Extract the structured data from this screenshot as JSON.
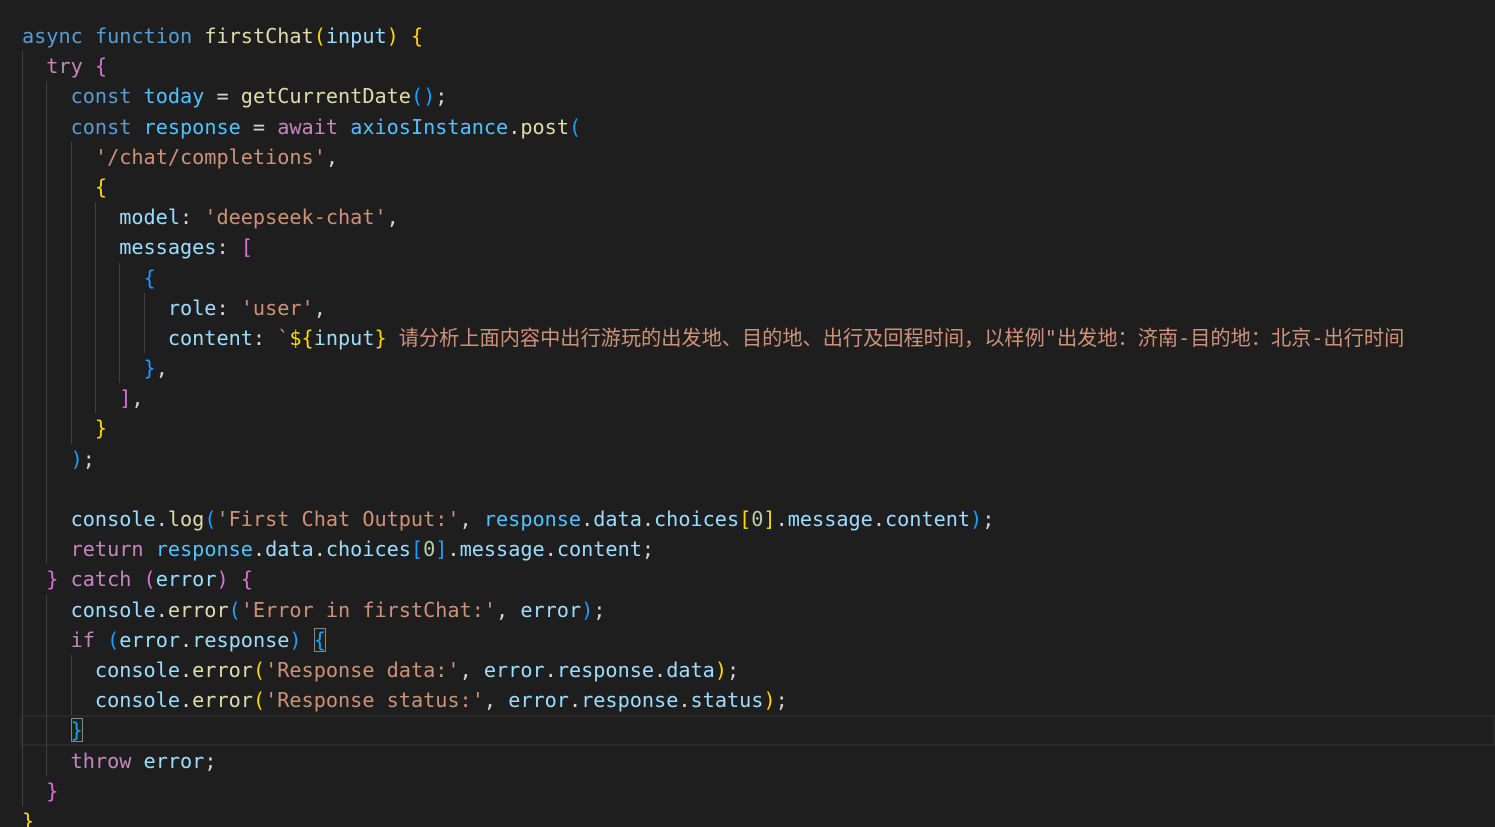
{
  "theme": {
    "background": "#1e1e1e",
    "text": "#d4d4d4",
    "indent_guide": "#404040",
    "line_highlight": "#282828",
    "bracket_match_border": "#888888",
    "token_colors": {
      "kw": "#569cd6",
      "ctl": "#c586c0",
      "fn": "#dcdcaa",
      "var": "#9cdcfe",
      "const": "#4fc1ff",
      "str": "#ce9178",
      "num": "#b5cea8",
      "p": "#d4d4d4",
      "b1": "#ffd700",
      "b2": "#da70d6",
      "b3": "#179fff"
    }
  },
  "lines": [
    {
      "indent": 0,
      "tokens": [
        {
          "t": "async",
          "c": "kw"
        },
        {
          "t": " ",
          "c": "p"
        },
        {
          "t": "function",
          "c": "kw"
        },
        {
          "t": " ",
          "c": "p"
        },
        {
          "t": "firstChat",
          "c": "fn"
        },
        {
          "t": "(",
          "c": "b1"
        },
        {
          "t": "input",
          "c": "var"
        },
        {
          "t": ")",
          "c": "b1"
        },
        {
          "t": " ",
          "c": "p"
        },
        {
          "t": "{",
          "c": "b1"
        }
      ]
    },
    {
      "indent": 2,
      "tokens": [
        {
          "t": "try",
          "c": "ctl"
        },
        {
          "t": " ",
          "c": "p"
        },
        {
          "t": "{",
          "c": "b2"
        }
      ]
    },
    {
      "indent": 4,
      "tokens": [
        {
          "t": "const",
          "c": "kw"
        },
        {
          "t": " ",
          "c": "p"
        },
        {
          "t": "today",
          "c": "const"
        },
        {
          "t": " = ",
          "c": "p"
        },
        {
          "t": "getCurrentDate",
          "c": "fn"
        },
        {
          "t": "()",
          "c": "b3"
        },
        {
          "t": ";",
          "c": "p"
        }
      ]
    },
    {
      "indent": 4,
      "tokens": [
        {
          "t": "const",
          "c": "kw"
        },
        {
          "t": " ",
          "c": "p"
        },
        {
          "t": "response",
          "c": "const"
        },
        {
          "t": " = ",
          "c": "p"
        },
        {
          "t": "await",
          "c": "ctl"
        },
        {
          "t": " ",
          "c": "p"
        },
        {
          "t": "axiosInstance",
          "c": "const"
        },
        {
          "t": ".",
          "c": "p"
        },
        {
          "t": "post",
          "c": "fn"
        },
        {
          "t": "(",
          "c": "b3"
        }
      ]
    },
    {
      "indent": 6,
      "tokens": [
        {
          "t": "'/chat/completions'",
          "c": "str"
        },
        {
          "t": ",",
          "c": "p"
        }
      ]
    },
    {
      "indent": 6,
      "tokens": [
        {
          "t": "{",
          "c": "b1"
        }
      ]
    },
    {
      "indent": 8,
      "tokens": [
        {
          "t": "model",
          "c": "var"
        },
        {
          "t": ": ",
          "c": "p"
        },
        {
          "t": "'deepseek-chat'",
          "c": "str"
        },
        {
          "t": ",",
          "c": "p"
        }
      ]
    },
    {
      "indent": 8,
      "tokens": [
        {
          "t": "messages",
          "c": "var"
        },
        {
          "t": ": ",
          "c": "p"
        },
        {
          "t": "[",
          "c": "b2"
        }
      ]
    },
    {
      "indent": 10,
      "tokens": [
        {
          "t": "{",
          "c": "b3"
        }
      ]
    },
    {
      "indent": 12,
      "tokens": [
        {
          "t": "role",
          "c": "var"
        },
        {
          "t": ": ",
          "c": "p"
        },
        {
          "t": "'user'",
          "c": "str"
        },
        {
          "t": ",",
          "c": "p"
        }
      ]
    },
    {
      "indent": 12,
      "tokens": [
        {
          "t": "content",
          "c": "var"
        },
        {
          "t": ": ",
          "c": "p"
        },
        {
          "t": "`",
          "c": "str"
        },
        {
          "t": "${",
          "c": "b1"
        },
        {
          "t": "input",
          "c": "var"
        },
        {
          "t": "}",
          "c": "b1"
        },
        {
          "t": " 请分析上面内容中出行游玩的出发地、目的地、出行及回程时间，以样例\"出发地：济南-目的地：北京-出行时间",
          "c": "str"
        }
      ]
    },
    {
      "indent": 10,
      "tokens": [
        {
          "t": "}",
          "c": "b3"
        },
        {
          "t": ",",
          "c": "p"
        }
      ]
    },
    {
      "indent": 8,
      "tokens": [
        {
          "t": "]",
          "c": "b2"
        },
        {
          "t": ",",
          "c": "p"
        }
      ]
    },
    {
      "indent": 6,
      "tokens": [
        {
          "t": "}",
          "c": "b1"
        }
      ]
    },
    {
      "indent": 4,
      "tokens": [
        {
          "t": ")",
          "c": "b3"
        },
        {
          "t": ";",
          "c": "p"
        }
      ]
    },
    {
      "indent": 4,
      "tokens": []
    },
    {
      "indent": 4,
      "tokens": [
        {
          "t": "console",
          "c": "var"
        },
        {
          "t": ".",
          "c": "p"
        },
        {
          "t": "log",
          "c": "fn"
        },
        {
          "t": "(",
          "c": "b3"
        },
        {
          "t": "'First Chat Output:'",
          "c": "str"
        },
        {
          "t": ", ",
          "c": "p"
        },
        {
          "t": "response",
          "c": "const"
        },
        {
          "t": ".",
          "c": "p"
        },
        {
          "t": "data",
          "c": "var"
        },
        {
          "t": ".",
          "c": "p"
        },
        {
          "t": "choices",
          "c": "var"
        },
        {
          "t": "[",
          "c": "b1"
        },
        {
          "t": "0",
          "c": "num"
        },
        {
          "t": "]",
          "c": "b1"
        },
        {
          "t": ".",
          "c": "p"
        },
        {
          "t": "message",
          "c": "var"
        },
        {
          "t": ".",
          "c": "p"
        },
        {
          "t": "content",
          "c": "var"
        },
        {
          "t": ")",
          "c": "b3"
        },
        {
          "t": ";",
          "c": "p"
        }
      ]
    },
    {
      "indent": 4,
      "tokens": [
        {
          "t": "return",
          "c": "ctl"
        },
        {
          "t": " ",
          "c": "p"
        },
        {
          "t": "response",
          "c": "const"
        },
        {
          "t": ".",
          "c": "p"
        },
        {
          "t": "data",
          "c": "var"
        },
        {
          "t": ".",
          "c": "p"
        },
        {
          "t": "choices",
          "c": "var"
        },
        {
          "t": "[",
          "c": "b3"
        },
        {
          "t": "0",
          "c": "num"
        },
        {
          "t": "]",
          "c": "b3"
        },
        {
          "t": ".",
          "c": "p"
        },
        {
          "t": "message",
          "c": "var"
        },
        {
          "t": ".",
          "c": "p"
        },
        {
          "t": "content",
          "c": "var"
        },
        {
          "t": ";",
          "c": "p"
        }
      ]
    },
    {
      "indent": 2,
      "tokens": [
        {
          "t": "}",
          "c": "b2"
        },
        {
          "t": " ",
          "c": "p"
        },
        {
          "t": "catch",
          "c": "ctl"
        },
        {
          "t": " ",
          "c": "p"
        },
        {
          "t": "(",
          "c": "b2"
        },
        {
          "t": "error",
          "c": "var"
        },
        {
          "t": ")",
          "c": "b2"
        },
        {
          "t": " ",
          "c": "p"
        },
        {
          "t": "{",
          "c": "b2"
        }
      ]
    },
    {
      "indent": 4,
      "tokens": [
        {
          "t": "console",
          "c": "var"
        },
        {
          "t": ".",
          "c": "p"
        },
        {
          "t": "error",
          "c": "fn"
        },
        {
          "t": "(",
          "c": "b3"
        },
        {
          "t": "'Error in firstChat:'",
          "c": "str"
        },
        {
          "t": ", ",
          "c": "p"
        },
        {
          "t": "error",
          "c": "var"
        },
        {
          "t": ")",
          "c": "b3"
        },
        {
          "t": ";",
          "c": "p"
        }
      ]
    },
    {
      "indent": 4,
      "tokens": [
        {
          "t": "if",
          "c": "ctl"
        },
        {
          "t": " ",
          "c": "p"
        },
        {
          "t": "(",
          "c": "b3"
        },
        {
          "t": "error",
          "c": "var"
        },
        {
          "t": ".",
          "c": "p"
        },
        {
          "t": "response",
          "c": "var"
        },
        {
          "t": ")",
          "c": "b3"
        },
        {
          "t": " ",
          "c": "p"
        },
        {
          "t": "{",
          "c": "b3",
          "match": true
        }
      ]
    },
    {
      "indent": 6,
      "tokens": [
        {
          "t": "console",
          "c": "var"
        },
        {
          "t": ".",
          "c": "p"
        },
        {
          "t": "error",
          "c": "fn"
        },
        {
          "t": "(",
          "c": "b1"
        },
        {
          "t": "'Response data:'",
          "c": "str"
        },
        {
          "t": ", ",
          "c": "p"
        },
        {
          "t": "error",
          "c": "var"
        },
        {
          "t": ".",
          "c": "p"
        },
        {
          "t": "response",
          "c": "var"
        },
        {
          "t": ".",
          "c": "p"
        },
        {
          "t": "data",
          "c": "var"
        },
        {
          "t": ")",
          "c": "b1"
        },
        {
          "t": ";",
          "c": "p"
        }
      ]
    },
    {
      "indent": 6,
      "tokens": [
        {
          "t": "console",
          "c": "var"
        },
        {
          "t": ".",
          "c": "p"
        },
        {
          "t": "error",
          "c": "fn"
        },
        {
          "t": "(",
          "c": "b1"
        },
        {
          "t": "'Response status:'",
          "c": "str"
        },
        {
          "t": ", ",
          "c": "p"
        },
        {
          "t": "error",
          "c": "var"
        },
        {
          "t": ".",
          "c": "p"
        },
        {
          "t": "response",
          "c": "var"
        },
        {
          "t": ".",
          "c": "p"
        },
        {
          "t": "status",
          "c": "var"
        },
        {
          "t": ")",
          "c": "b1"
        },
        {
          "t": ";",
          "c": "p"
        }
      ]
    },
    {
      "indent": 4,
      "active": true,
      "tokens": [
        {
          "t": "}",
          "c": "b3",
          "match": true
        }
      ]
    },
    {
      "indent": 4,
      "tokens": [
        {
          "t": "throw",
          "c": "ctl"
        },
        {
          "t": " ",
          "c": "p"
        },
        {
          "t": "error",
          "c": "var"
        },
        {
          "t": ";",
          "c": "p"
        }
      ]
    },
    {
      "indent": 2,
      "tokens": [
        {
          "t": "}",
          "c": "b2"
        }
      ]
    },
    {
      "indent": 0,
      "tokens": [
        {
          "t": "}",
          "c": "b1"
        }
      ]
    }
  ]
}
